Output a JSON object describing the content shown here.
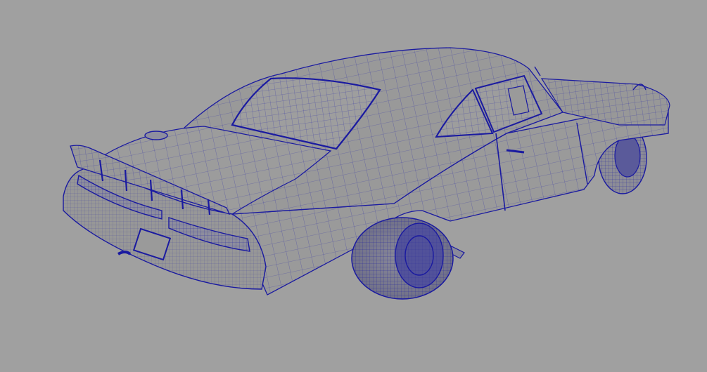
{
  "viewport": {
    "background": "#a0a0a0",
    "wire_color": "#1a1aa0",
    "shade_color": "#9b9b9b",
    "model": "car-wireframe-mesh"
  }
}
